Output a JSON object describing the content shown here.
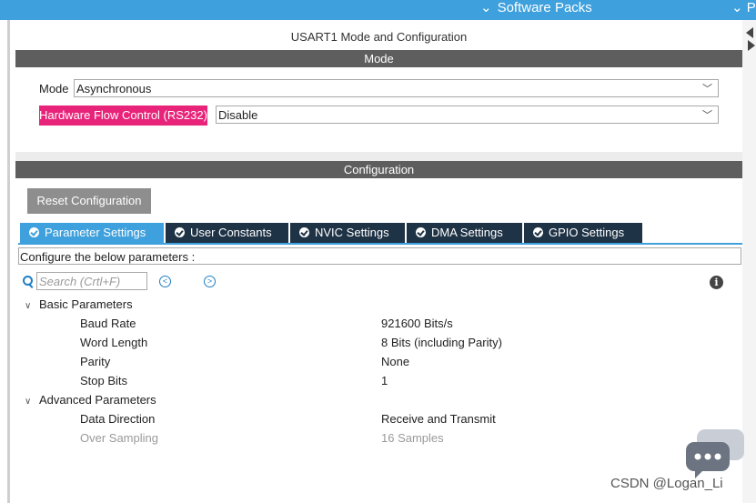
{
  "topbar": {
    "software_packs": "Software Packs",
    "right_edge": "P"
  },
  "usart": {
    "title": "USART1 Mode and Configuration",
    "mode_header": "Mode",
    "mode_label": "Mode",
    "mode_value": "Asynchronous",
    "flow_label": "Hardware Flow Control (RS232)",
    "flow_value": "Disable"
  },
  "configuration": {
    "header": "Configuration",
    "reset_label": "Reset Configuration",
    "tabs": [
      {
        "label": "Parameter Settings",
        "active": true
      },
      {
        "label": "User Constants",
        "active": false
      },
      {
        "label": "NVIC Settings",
        "active": false
      },
      {
        "label": "DMA Settings",
        "active": false
      },
      {
        "label": "GPIO Settings",
        "active": false
      }
    ],
    "configure_text": "Configure the below parameters :",
    "search_placeholder": "Search (Crtl+F)",
    "prev_glyph": "<",
    "next_glyph": ">",
    "info_glyph": "i"
  },
  "basic": {
    "label": "Basic Parameters",
    "params": [
      {
        "name": "Baud Rate",
        "value": "921600 Bits/s"
      },
      {
        "name": "Word Length",
        "value": "8 Bits (including Parity)"
      },
      {
        "name": "Parity",
        "value": "None"
      },
      {
        "name": "Stop Bits",
        "value": "1"
      }
    ]
  },
  "advanced": {
    "label": "Advanced Parameters",
    "params": [
      {
        "name": "Data Direction",
        "value": "Receive and Transmit"
      },
      {
        "name": "Over Sampling",
        "value": "16 Samples"
      }
    ]
  },
  "watermark": "CSDN @Logan_Li",
  "icons": {
    "chevron_down": "chevron-down-icon",
    "check": "check-circle-icon",
    "search": "search-icon",
    "info": "info-icon",
    "chat": "chat-bubble-icon"
  },
  "colors": {
    "accent_blue": "#3ea0dc",
    "tab_dark": "#1f3346",
    "header_gray": "#5e5e5e",
    "highlight_pink": "#e8247a",
    "button_gray": "#8e8e8e"
  }
}
